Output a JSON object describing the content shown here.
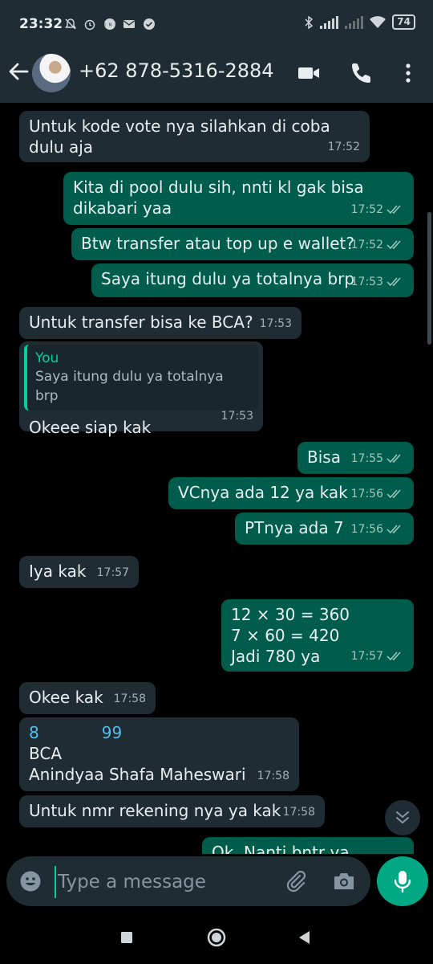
{
  "status_bar": {
    "time": "23:32",
    "notifications": [
      "bell-off-icon",
      "alarm-icon",
      "line-icon",
      "mail-icon",
      "check-icon"
    ],
    "battery": "74"
  },
  "header": {
    "contact": "+62 878-5316-2884",
    "icons": [
      "back-arrow-icon",
      "video-call-icon",
      "phone-icon",
      "more-vert-icon"
    ]
  },
  "messages": [
    {
      "dir": "in",
      "text": "Untuk kode vote nya silahkan di coba dulu aja",
      "time": "17:52"
    },
    {
      "dir": "out",
      "text": "Kita di pool dulu sih, nnti kl gak bisa dikabari yaa",
      "time": "17:52"
    },
    {
      "dir": "out",
      "text": "Btw transfer atau top up e wallet?",
      "time": "17:52"
    },
    {
      "dir": "out",
      "text": "Saya itung dulu ya totalnya brp",
      "time": "17:53"
    },
    {
      "dir": "in",
      "text": "Untuk transfer bisa ke BCA?",
      "time": "17:53"
    },
    {
      "dir": "in",
      "quote_author": "You",
      "quote_text": "Saya itung dulu ya totalnya brp",
      "text": "Okeee siap kak",
      "time": "17:53"
    },
    {
      "dir": "out",
      "text": "Bisa",
      "time": "17:55"
    },
    {
      "dir": "out",
      "text": "VCnya ada 12 ya kak",
      "time": "17:56"
    },
    {
      "dir": "out",
      "text": "PTnya ada 7",
      "time": "17:56"
    },
    {
      "dir": "in",
      "text": "Iya kak",
      "time": "17:57"
    },
    {
      "dir": "out",
      "lines": [
        "12 × 30  = 360",
        "7 × 60 = 420",
        "Jadi 780 ya"
      ],
      "time": "17:57"
    },
    {
      "dir": "in",
      "text": "Okee kak",
      "time": "17:58"
    },
    {
      "dir": "in",
      "acct_first": "8",
      "acct_last": "99",
      "lines": [
        "BCA",
        "Anindyaa Shafa Maheswari"
      ],
      "time": "17:58"
    },
    {
      "dir": "in",
      "text": "Untuk nmr rekening nya ya kak",
      "time": "17:58"
    },
    {
      "dir": "out",
      "text": "Ok. Nanti bntr ya"
    }
  ],
  "composer": {
    "placeholder": "Type a message"
  }
}
